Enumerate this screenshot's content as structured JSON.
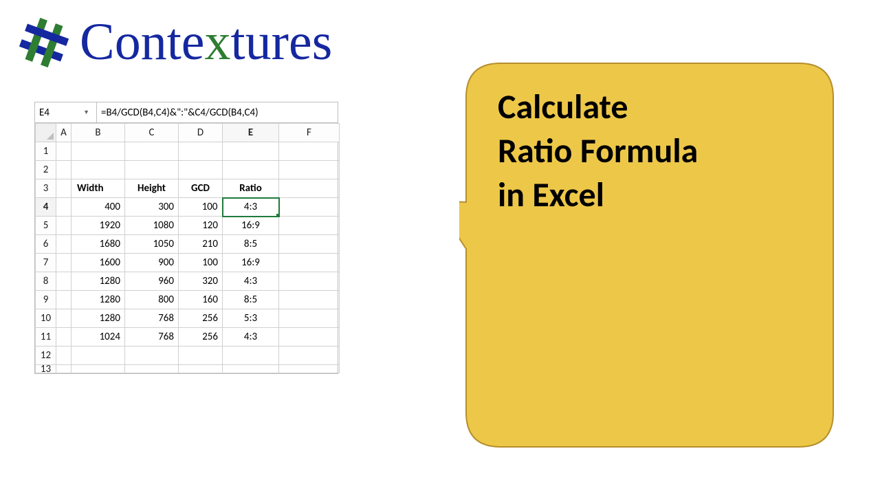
{
  "brand": {
    "name_pre": "Conte",
    "name_x": "x",
    "name_post": "tures"
  },
  "callout": {
    "line1": "Calculate",
    "line2": "Ratio Formula",
    "line3": "in Excel"
  },
  "sheet": {
    "name_box": "E4",
    "formula": "=B4/GCD(B4,C4)&\":\"&C4/GCD(B4,C4)",
    "cols": [
      "A",
      "B",
      "C",
      "D",
      "E",
      "F"
    ],
    "active_col": "E",
    "active_row": "4",
    "headers": {
      "b": "Width",
      "c": "Height",
      "d": "GCD",
      "e": "Ratio"
    },
    "rows": [
      {
        "n": "1"
      },
      {
        "n": "2"
      },
      {
        "n": "3",
        "header": true
      },
      {
        "n": "4",
        "b": "400",
        "c": "300",
        "d": "100",
        "e": "4:3",
        "active": true
      },
      {
        "n": "5",
        "b": "1920",
        "c": "1080",
        "d": "120",
        "e": "16:9"
      },
      {
        "n": "6",
        "b": "1680",
        "c": "1050",
        "d": "210",
        "e": "8:5"
      },
      {
        "n": "7",
        "b": "1600",
        "c": "900",
        "d": "100",
        "e": "16:9"
      },
      {
        "n": "8",
        "b": "1280",
        "c": "960",
        "d": "320",
        "e": "4:3"
      },
      {
        "n": "9",
        "b": "1280",
        "c": "800",
        "d": "160",
        "e": "8:5"
      },
      {
        "n": "10",
        "b": "1280",
        "c": "768",
        "d": "256",
        "e": "5:3"
      },
      {
        "n": "11",
        "b": "1024",
        "c": "768",
        "d": "256",
        "e": "4:3"
      },
      {
        "n": "12"
      },
      {
        "n": "13",
        "clipped": true
      }
    ]
  },
  "chart_data": {
    "type": "table",
    "title": "Calculate Ratio Formula in Excel",
    "columns": [
      "Width",
      "Height",
      "GCD",
      "Ratio"
    ],
    "rows": [
      [
        400,
        300,
        100,
        "4:3"
      ],
      [
        1920,
        1080,
        120,
        "16:9"
      ],
      [
        1680,
        1050,
        210,
        "8:5"
      ],
      [
        1600,
        900,
        100,
        "16:9"
      ],
      [
        1280,
        960,
        320,
        "4:3"
      ],
      [
        1280,
        800,
        160,
        "8:5"
      ],
      [
        1280,
        768,
        256,
        "5:3"
      ],
      [
        1024,
        768,
        256,
        "4:3"
      ]
    ]
  }
}
